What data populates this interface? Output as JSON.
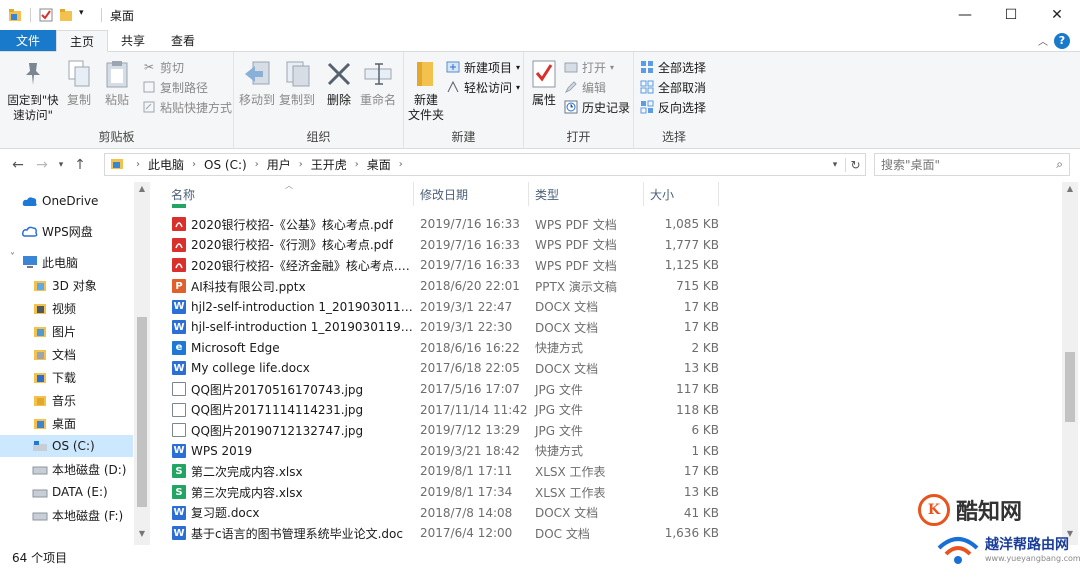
{
  "window": {
    "title": "桌面",
    "minimize": "—",
    "maximize": "☐",
    "close": "✕"
  },
  "tabs": {
    "file": "文件",
    "home": "主页",
    "share": "共享",
    "view": "查看"
  },
  "ribbon": {
    "clipboard": {
      "label": "剪贴板",
      "pin": "固定到\"快速访问\"",
      "copy": "复制",
      "paste": "粘贴",
      "cut": "剪切",
      "copy_path": "复制路径",
      "paste_shortcut": "粘贴快捷方式"
    },
    "organize": {
      "label": "组织",
      "move_to": "移动到",
      "copy_to": "复制到",
      "delete": "删除",
      "rename": "重命名"
    },
    "new": {
      "label": "新建",
      "new_folder": "新建\n文件夹",
      "new_item": "新建项目",
      "easy_access": "轻松访问"
    },
    "open": {
      "label": "打开",
      "properties": "属性",
      "open": "打开",
      "edit": "编辑",
      "history": "历史记录"
    },
    "select": {
      "label": "选择",
      "select_all": "全部选择",
      "select_none": "全部取消",
      "invert": "反向选择"
    }
  },
  "address": {
    "crumbs": [
      "此电脑",
      "OS (C:)",
      "用户",
      "王开虎",
      "桌面"
    ],
    "search_placeholder": "搜索\"桌面\""
  },
  "nav": {
    "items": [
      {
        "label": "OneDrive",
        "icon": "cloud-icon"
      },
      {
        "label": "WPS网盘",
        "icon": "wps-cloud-icon"
      },
      {
        "label": "此电脑",
        "icon": "computer-icon"
      },
      {
        "label": "3D 对象",
        "icon": "3d-objects-icon"
      },
      {
        "label": "视频",
        "icon": "video-folder-icon"
      },
      {
        "label": "图片",
        "icon": "pictures-folder-icon"
      },
      {
        "label": "文档",
        "icon": "documents-folder-icon"
      },
      {
        "label": "下载",
        "icon": "downloads-folder-icon"
      },
      {
        "label": "音乐",
        "icon": "music-folder-icon"
      },
      {
        "label": "桌面",
        "icon": "desktop-folder-icon"
      },
      {
        "label": "OS (C:)",
        "icon": "os-drive-icon",
        "selected": true
      },
      {
        "label": "本地磁盘 (D:)",
        "icon": "drive-icon"
      },
      {
        "label": "DATA (E:)",
        "icon": "drive-icon"
      },
      {
        "label": "本地磁盘 (F:)",
        "icon": "drive-icon"
      }
    ]
  },
  "list": {
    "columns": {
      "name": "名称",
      "date": "修改日期",
      "type": "类型",
      "size": "大小"
    },
    "rows": [
      {
        "name": "2020银行校招-《公基》核心考点.pdf",
        "date": "2019/7/16 16:33",
        "type": "WPS PDF 文档",
        "size": "1,085 KB",
        "kind": "pdf"
      },
      {
        "name": "2020银行校招-《行测》核心考点.pdf",
        "date": "2019/7/16 16:33",
        "type": "WPS PDF 文档",
        "size": "1,777 KB",
        "kind": "pdf"
      },
      {
        "name": "2020银行校招-《经济金融》核心考点.pdf",
        "date": "2019/7/16 16:33",
        "type": "WPS PDF 文档",
        "size": "1,125 KB",
        "kind": "pdf"
      },
      {
        "name": "AI科技有限公司.pptx",
        "date": "2018/6/20 22:01",
        "type": "PPTX 演示文稿",
        "size": "715 KB",
        "kind": "pptx"
      },
      {
        "name": "hjl2-self-introduction 1_20190301190...",
        "date": "2019/3/1 22:47",
        "type": "DOCX 文档",
        "size": "17 KB",
        "kind": "docx"
      },
      {
        "name": "hjl-self-introduction 1_20190301195...",
        "date": "2019/3/1 22:30",
        "type": "DOCX 文档",
        "size": "17 KB",
        "kind": "docx"
      },
      {
        "name": "Microsoft Edge",
        "date": "2018/6/16 16:22",
        "type": "快捷方式",
        "size": "2 KB",
        "kind": "edge"
      },
      {
        "name": "My college life.docx",
        "date": "2017/6/18 22:05",
        "type": "DOCX 文档",
        "size": "13 KB",
        "kind": "docx"
      },
      {
        "name": "QQ图片20170516170743.jpg",
        "date": "2017/5/16 17:07",
        "type": "JPG 文件",
        "size": "117 KB",
        "kind": "jpg"
      },
      {
        "name": "QQ图片20171114114231.jpg",
        "date": "2017/11/14 11:42",
        "type": "JPG 文件",
        "size": "118 KB",
        "kind": "jpg"
      },
      {
        "name": "QQ图片20190712132747.jpg",
        "date": "2019/7/12 13:29",
        "type": "JPG 文件",
        "size": "6 KB",
        "kind": "jpg"
      },
      {
        "name": "WPS 2019",
        "date": "2019/3/21 18:42",
        "type": "快捷方式",
        "size": "1 KB",
        "kind": "wps"
      },
      {
        "name": "第二次完成内容.xlsx",
        "date": "2019/8/1 17:11",
        "type": "XLSX 工作表",
        "size": "17 KB",
        "kind": "xlsx"
      },
      {
        "name": "第三次完成内容.xlsx",
        "date": "2019/8/1 17:34",
        "type": "XLSX 工作表",
        "size": "13 KB",
        "kind": "xlsx"
      },
      {
        "name": "复习题.docx",
        "date": "2018/7/8 14:08",
        "type": "DOCX 文档",
        "size": "41 KB",
        "kind": "docx"
      },
      {
        "name": "基于c语言的图书管理系统毕业论文.doc",
        "date": "2017/6/4 12:00",
        "type": "DOC 文档",
        "size": "1,636 KB",
        "kind": "docx"
      }
    ]
  },
  "status": {
    "count": "64 个项目"
  },
  "watermarks": {
    "kuzhi": "酷知网",
    "kuzhi_logo": "K",
    "router": "越洋帮路由网",
    "router_url": "www.yueyangbang.com"
  },
  "colors": {
    "file_tab": "#1979ca",
    "selection": "#cce8ff",
    "pdf": "#d9302b",
    "docx": "#2b6fd6",
    "xlsx": "#22a462",
    "pptx": "#e0602c"
  }
}
